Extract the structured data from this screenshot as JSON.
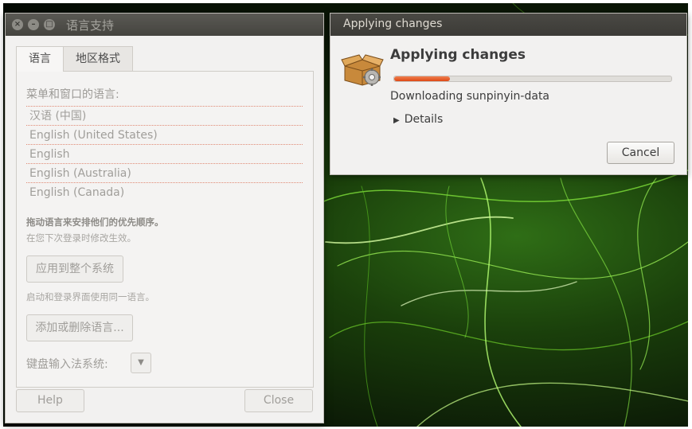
{
  "language_window": {
    "title": "语言支持",
    "tabs": [
      {
        "label": "语言",
        "active": true
      },
      {
        "label": "地区格式",
        "active": false
      }
    ],
    "list_header": "菜单和窗口的语言:",
    "languages": [
      "汉语 (中国)",
      "English (United States)",
      "English",
      "English (Australia)",
      "English (Canada)"
    ],
    "drag_note": "拖动语言来安排他们的优先顺序。",
    "effect_note": "在您下次登录时修改生效。",
    "apply_system_button": "应用到整个系统",
    "login_note": "启动和登录界面使用同一语言。",
    "add_remove_button": "添加或删除语言...",
    "keyboard_label": "键盘输入法系统:",
    "help_button": "Help",
    "close_button": "Close"
  },
  "apply_dialog": {
    "titlebar": "Applying changes",
    "heading": "Applying changes",
    "progress_percent": 20,
    "status": "Downloading sunpinyin-data",
    "details_label": "Details",
    "cancel_button": "Cancel"
  },
  "colors": {
    "accent": "#dd4814",
    "titlebar": "#3c3b37",
    "window_bg": "#f2f1f0"
  },
  "icons": {
    "close": "close-icon",
    "minimize": "minimize-icon",
    "maximize": "maximize-icon",
    "package": "package-gear-icon",
    "expander": "triangle-right-icon",
    "dropdown": "chevron-down-icon"
  }
}
